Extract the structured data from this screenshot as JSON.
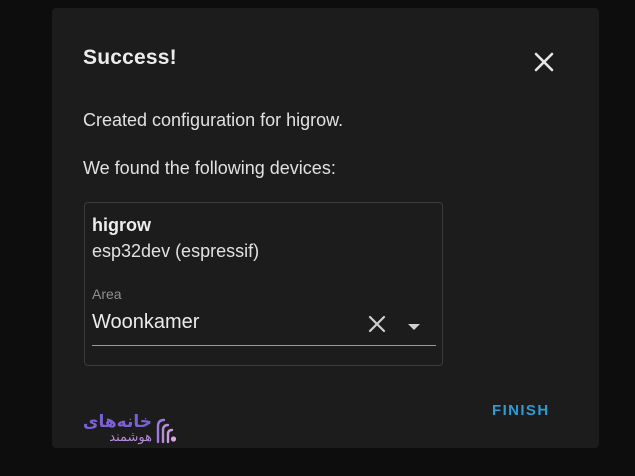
{
  "dialog": {
    "title": "Success!",
    "message": "Created configuration for higrow.",
    "devices_heading": "We found the following devices:",
    "finish_label": "FINISH"
  },
  "device": {
    "name": "higrow",
    "model": "esp32dev (espressif)",
    "area_label": "Area",
    "area_value": "Woonkamer"
  },
  "watermark": {
    "line1": "خانه‌های",
    "line2": "هوشمند"
  },
  "icons": {
    "close": "close-icon",
    "clear": "clear-icon",
    "dropdown": "dropdown-arrow-icon",
    "logo": "wifi-logo-icon"
  },
  "colors": {
    "background": "#0d0d0d",
    "dialog": "#1c1c1c",
    "accent": "#2e9ad6",
    "text": "#e1e1e1",
    "muted": "#8f8f8f"
  }
}
